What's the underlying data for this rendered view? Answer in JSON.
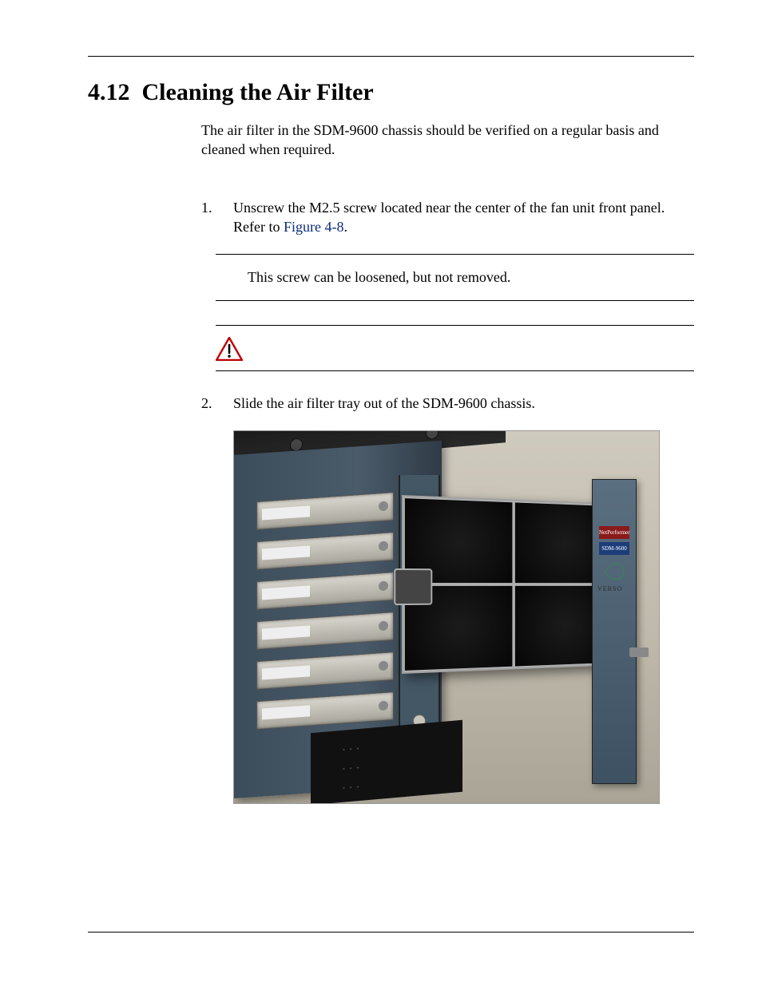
{
  "section": {
    "number": "4.12",
    "title": "Cleaning the Air Filter"
  },
  "intro": "The air filter in the SDM-9600 chassis should be verified on a regular basis and cleaned when required.",
  "steps": {
    "s1_num": "1.",
    "s1_text_a": "Unscrew the M2.5 screw located near the center of the fan unit front panel. Refer to ",
    "s1_link": "Figure 4-8",
    "s1_text_b": ".",
    "s2_num": "2.",
    "s2_text": "Slide the air filter tray out of the SDM-9600 chassis."
  },
  "note": {
    "text": "This screw can be loosened, but not removed."
  },
  "photo_labels": {
    "badge_red": "NetPerformer",
    "badge_blue": "SDM-9600",
    "vendor": "VERSO"
  }
}
